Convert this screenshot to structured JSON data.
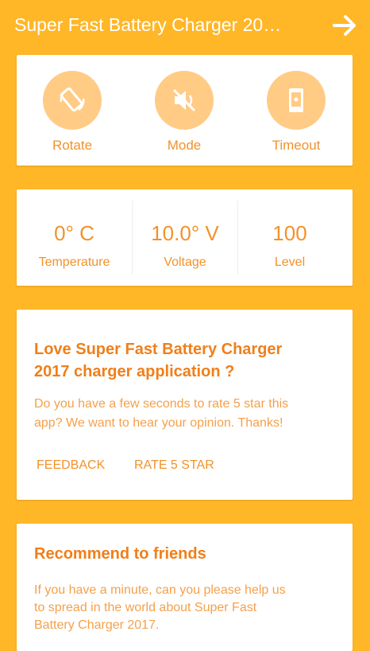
{
  "appbar": {
    "title": "Super Fast Battery Charger 20…"
  },
  "quick_actions": [
    {
      "label": "Rotate",
      "icon": "rotate-icon"
    },
    {
      "label": "Mode",
      "icon": "mute-icon"
    },
    {
      "label": "Timeout",
      "icon": "phone-timeout-icon"
    }
  ],
  "stats": [
    {
      "value": "0° C",
      "label": "Temperature"
    },
    {
      "value": "10.0° V",
      "label": "Voltage"
    },
    {
      "value": "100",
      "label": "Level"
    }
  ],
  "rate_card": {
    "heading_line1": "Love Super Fast Battery Charger",
    "heading_line2": "2017 charger application ?",
    "body_line1": "Do you have a few seconds to rate 5 star this",
    "body_line2": "app? We want to hear your opinion. Thanks!",
    "feedback_label": "FEEDBACK",
    "rate_label": "RATE 5 STAR"
  },
  "recommend_card": {
    "heading": "Recommend to friends",
    "body_line1": "If you have a minute, can you please help us",
    "body_line2": "to spread in the world about Super Fast",
    "body_line3": "Battery Charger 2017."
  },
  "colors": {
    "background": "#FFB627",
    "accent": "#F2922A",
    "icon_circle": "#FFCB85"
  }
}
